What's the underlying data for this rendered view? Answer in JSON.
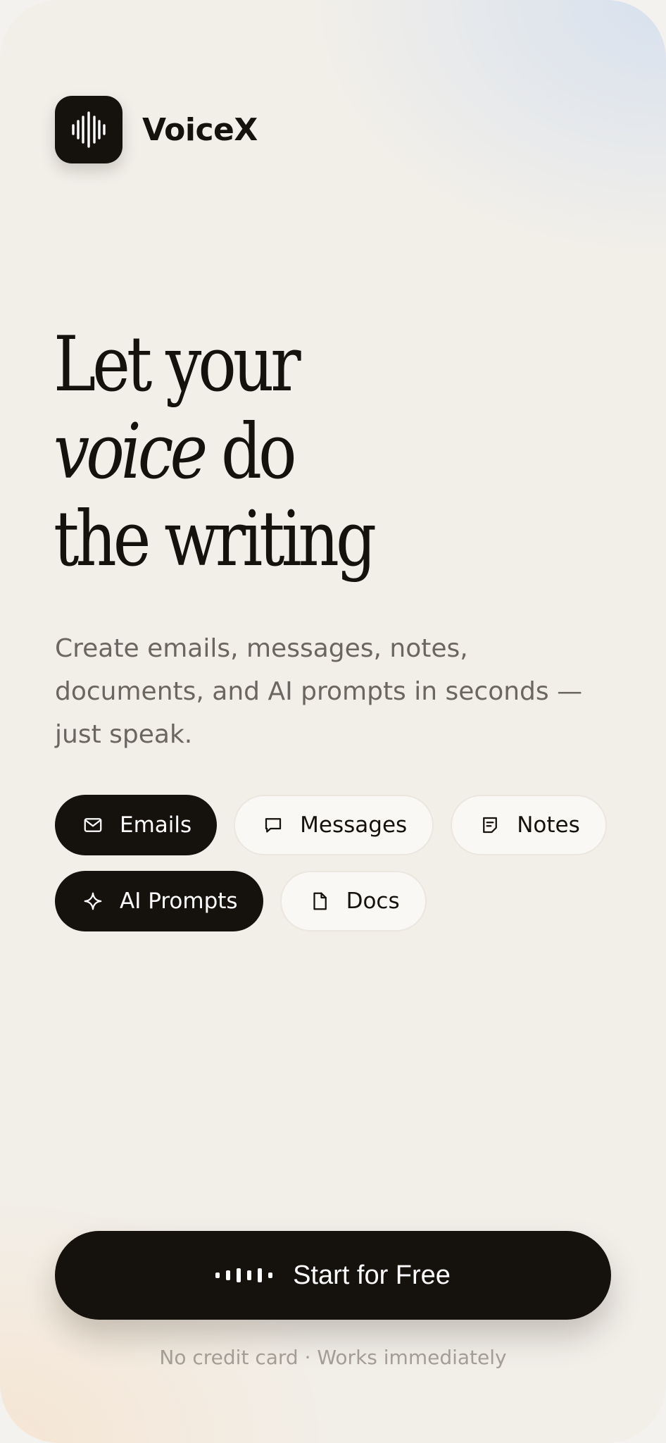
{
  "brand": {
    "name": "VoiceX",
    "logo_icon": "waveform-icon"
  },
  "hero": {
    "headline_line1": "Let your",
    "headline_line2_italic": "voice",
    "headline_line2_rest": "do",
    "headline_line3": "the writing",
    "subtext": "Create emails, messages, notes, documents, and AI prompts in seconds — just speak."
  },
  "chips": [
    {
      "label": "Emails",
      "icon": "mail-icon",
      "active": true
    },
    {
      "label": "Messages",
      "icon": "message-bubble-icon",
      "active": false
    },
    {
      "label": "Notes",
      "icon": "note-icon",
      "active": false
    },
    {
      "label": "AI Prompts",
      "icon": "sparkle-icon",
      "active": true
    },
    {
      "label": "Docs",
      "icon": "document-icon",
      "active": false
    }
  ],
  "cta": {
    "label": "Start for Free",
    "icon": "audio-dots-icon"
  },
  "footnote": "No credit card · Works immediately",
  "colors": {
    "ink": "#15110d",
    "muted_text": "#6c6660",
    "chip_inactive_bg": "#faf8f5",
    "footnote": "#a39d95"
  }
}
